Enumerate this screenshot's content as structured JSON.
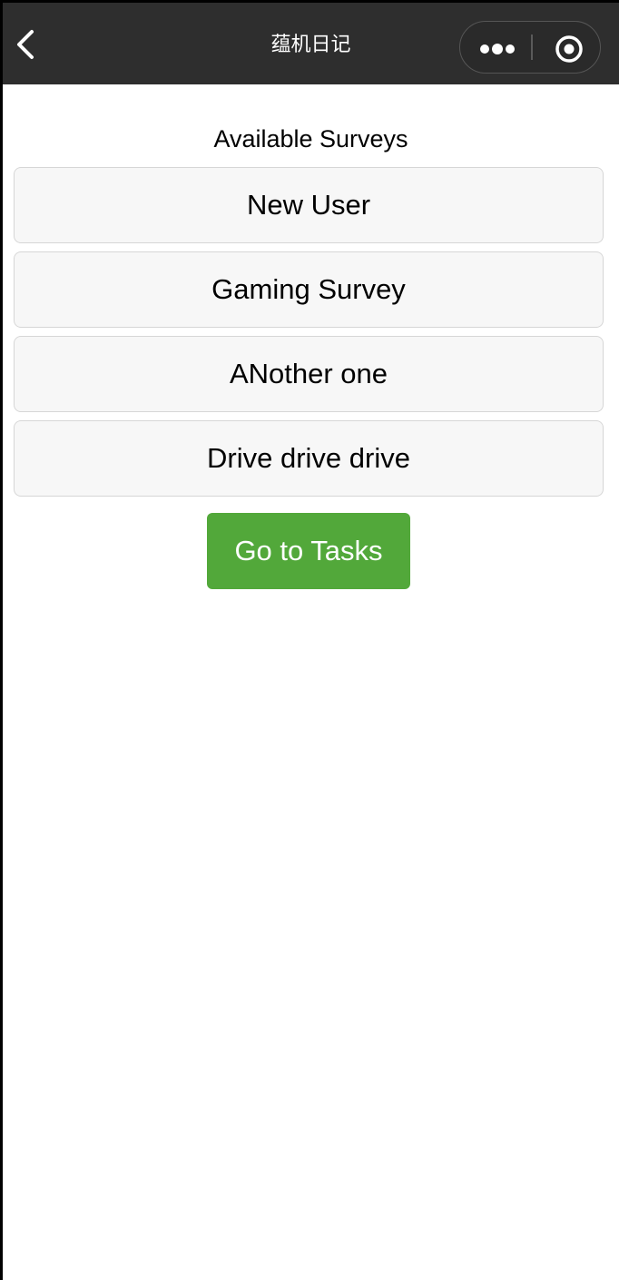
{
  "navbar": {
    "title": "蕴机日记",
    "background": "#2e2e2e",
    "back_icon": "chevron-left-icon",
    "more_icon": "more-dots-icon",
    "close_icon": "target-circle-icon"
  },
  "main": {
    "heading": "Available Surveys",
    "surveys": [
      {
        "label": "New User"
      },
      {
        "label": "Gaming Survey"
      },
      {
        "label": "ANother one"
      },
      {
        "label": "Drive drive drive"
      }
    ],
    "tasks_button": {
      "label": "Go to Tasks",
      "color": "#52a83a"
    }
  }
}
